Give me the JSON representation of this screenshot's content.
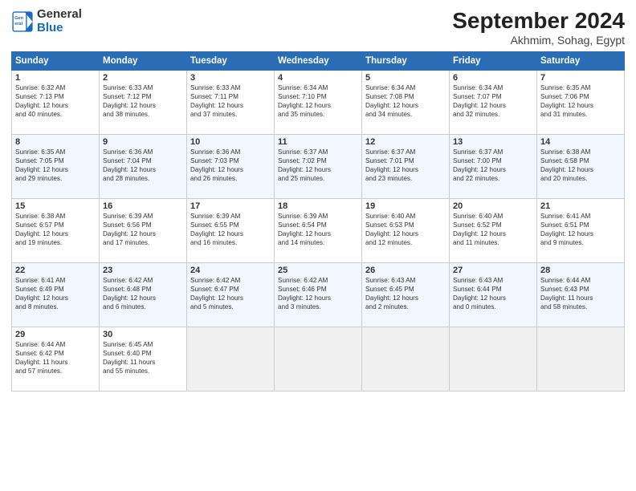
{
  "header": {
    "logo_line1": "General",
    "logo_line2": "Blue",
    "month": "September 2024",
    "location": "Akhmim, Sohag, Egypt"
  },
  "days_of_week": [
    "Sunday",
    "Monday",
    "Tuesday",
    "Wednesday",
    "Thursday",
    "Friday",
    "Saturday"
  ],
  "weeks": [
    [
      {
        "day": "1",
        "lines": [
          "Sunrise: 6:32 AM",
          "Sunset: 7:13 PM",
          "Daylight: 12 hours",
          "and 40 minutes."
        ]
      },
      {
        "day": "2",
        "lines": [
          "Sunrise: 6:33 AM",
          "Sunset: 7:12 PM",
          "Daylight: 12 hours",
          "and 38 minutes."
        ]
      },
      {
        "day": "3",
        "lines": [
          "Sunrise: 6:33 AM",
          "Sunset: 7:11 PM",
          "Daylight: 12 hours",
          "and 37 minutes."
        ]
      },
      {
        "day": "4",
        "lines": [
          "Sunrise: 6:34 AM",
          "Sunset: 7:10 PM",
          "Daylight: 12 hours",
          "and 35 minutes."
        ]
      },
      {
        "day": "5",
        "lines": [
          "Sunrise: 6:34 AM",
          "Sunset: 7:08 PM",
          "Daylight: 12 hours",
          "and 34 minutes."
        ]
      },
      {
        "day": "6",
        "lines": [
          "Sunrise: 6:34 AM",
          "Sunset: 7:07 PM",
          "Daylight: 12 hours",
          "and 32 minutes."
        ]
      },
      {
        "day": "7",
        "lines": [
          "Sunrise: 6:35 AM",
          "Sunset: 7:06 PM",
          "Daylight: 12 hours",
          "and 31 minutes."
        ]
      }
    ],
    [
      {
        "day": "8",
        "lines": [
          "Sunrise: 6:35 AM",
          "Sunset: 7:05 PM",
          "Daylight: 12 hours",
          "and 29 minutes."
        ]
      },
      {
        "day": "9",
        "lines": [
          "Sunrise: 6:36 AM",
          "Sunset: 7:04 PM",
          "Daylight: 12 hours",
          "and 28 minutes."
        ]
      },
      {
        "day": "10",
        "lines": [
          "Sunrise: 6:36 AM",
          "Sunset: 7:03 PM",
          "Daylight: 12 hours",
          "and 26 minutes."
        ]
      },
      {
        "day": "11",
        "lines": [
          "Sunrise: 6:37 AM",
          "Sunset: 7:02 PM",
          "Daylight: 12 hours",
          "and 25 minutes."
        ]
      },
      {
        "day": "12",
        "lines": [
          "Sunrise: 6:37 AM",
          "Sunset: 7:01 PM",
          "Daylight: 12 hours",
          "and 23 minutes."
        ]
      },
      {
        "day": "13",
        "lines": [
          "Sunrise: 6:37 AM",
          "Sunset: 7:00 PM",
          "Daylight: 12 hours",
          "and 22 minutes."
        ]
      },
      {
        "day": "14",
        "lines": [
          "Sunrise: 6:38 AM",
          "Sunset: 6:58 PM",
          "Daylight: 12 hours",
          "and 20 minutes."
        ]
      }
    ],
    [
      {
        "day": "15",
        "lines": [
          "Sunrise: 6:38 AM",
          "Sunset: 6:57 PM",
          "Daylight: 12 hours",
          "and 19 minutes."
        ]
      },
      {
        "day": "16",
        "lines": [
          "Sunrise: 6:39 AM",
          "Sunset: 6:56 PM",
          "Daylight: 12 hours",
          "and 17 minutes."
        ]
      },
      {
        "day": "17",
        "lines": [
          "Sunrise: 6:39 AM",
          "Sunset: 6:55 PM",
          "Daylight: 12 hours",
          "and 16 minutes."
        ]
      },
      {
        "day": "18",
        "lines": [
          "Sunrise: 6:39 AM",
          "Sunset: 6:54 PM",
          "Daylight: 12 hours",
          "and 14 minutes."
        ]
      },
      {
        "day": "19",
        "lines": [
          "Sunrise: 6:40 AM",
          "Sunset: 6:53 PM",
          "Daylight: 12 hours",
          "and 12 minutes."
        ]
      },
      {
        "day": "20",
        "lines": [
          "Sunrise: 6:40 AM",
          "Sunset: 6:52 PM",
          "Daylight: 12 hours",
          "and 11 minutes."
        ]
      },
      {
        "day": "21",
        "lines": [
          "Sunrise: 6:41 AM",
          "Sunset: 6:51 PM",
          "Daylight: 12 hours",
          "and 9 minutes."
        ]
      }
    ],
    [
      {
        "day": "22",
        "lines": [
          "Sunrise: 6:41 AM",
          "Sunset: 6:49 PM",
          "Daylight: 12 hours",
          "and 8 minutes."
        ]
      },
      {
        "day": "23",
        "lines": [
          "Sunrise: 6:42 AM",
          "Sunset: 6:48 PM",
          "Daylight: 12 hours",
          "and 6 minutes."
        ]
      },
      {
        "day": "24",
        "lines": [
          "Sunrise: 6:42 AM",
          "Sunset: 6:47 PM",
          "Daylight: 12 hours",
          "and 5 minutes."
        ]
      },
      {
        "day": "25",
        "lines": [
          "Sunrise: 6:42 AM",
          "Sunset: 6:46 PM",
          "Daylight: 12 hours",
          "and 3 minutes."
        ]
      },
      {
        "day": "26",
        "lines": [
          "Sunrise: 6:43 AM",
          "Sunset: 6:45 PM",
          "Daylight: 12 hours",
          "and 2 minutes."
        ]
      },
      {
        "day": "27",
        "lines": [
          "Sunrise: 6:43 AM",
          "Sunset: 6:44 PM",
          "Daylight: 12 hours",
          "and 0 minutes."
        ]
      },
      {
        "day": "28",
        "lines": [
          "Sunrise: 6:44 AM",
          "Sunset: 6:43 PM",
          "Daylight: 11 hours",
          "and 58 minutes."
        ]
      }
    ],
    [
      {
        "day": "29",
        "lines": [
          "Sunrise: 6:44 AM",
          "Sunset: 6:42 PM",
          "Daylight: 11 hours",
          "and 57 minutes."
        ]
      },
      {
        "day": "30",
        "lines": [
          "Sunrise: 6:45 AM",
          "Sunset: 6:40 PM",
          "Daylight: 11 hours",
          "and 55 minutes."
        ]
      },
      {
        "day": "",
        "lines": []
      },
      {
        "day": "",
        "lines": []
      },
      {
        "day": "",
        "lines": []
      },
      {
        "day": "",
        "lines": []
      },
      {
        "day": "",
        "lines": []
      }
    ]
  ]
}
